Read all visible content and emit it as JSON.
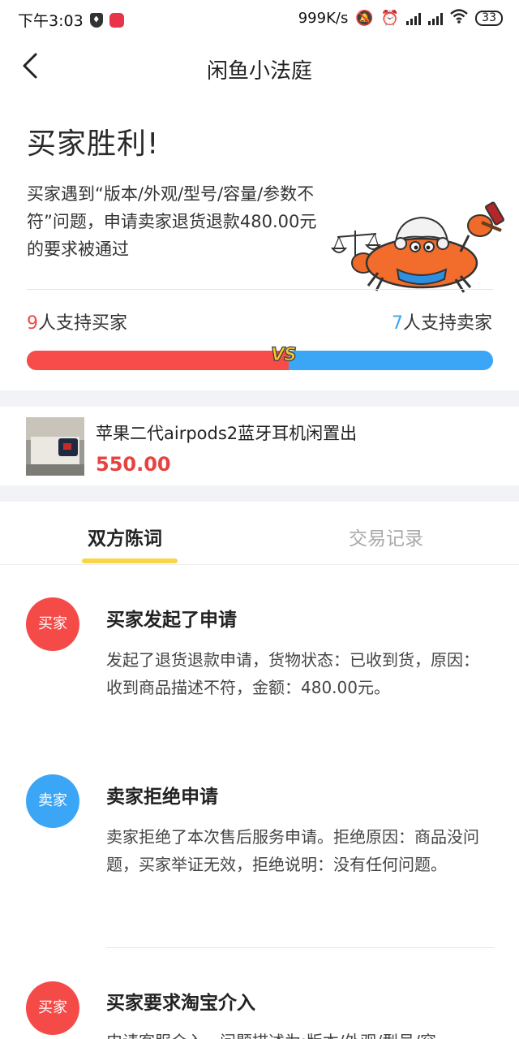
{
  "status_bar": {
    "time": "下午3:03",
    "network_speed": "999K/s",
    "battery": "33"
  },
  "header": {
    "title": "闲鱼小法庭"
  },
  "verdict": {
    "title": "买家胜利!",
    "description": "买家遇到“版本/外观/型号/容量/参数不符”问题，申请卖家退货退款480.00元的要求被通过"
  },
  "support": {
    "buyer_count": "9",
    "buyer_label": "人支持买家",
    "seller_count": "7",
    "seller_label": "人支持卖家",
    "buyer_share": 0.5625,
    "vs_label": "VS"
  },
  "product": {
    "name": "苹果二代airpods2蓝牙耳机闲置出",
    "price": "550.00"
  },
  "tabs": [
    {
      "label": "双方陈词",
      "active": true
    },
    {
      "label": "交易记录",
      "active": false
    }
  ],
  "timeline": [
    {
      "role": "买家",
      "role_color": "#f44b49",
      "title": "买家发起了申请",
      "body": "发起了退货退款申请，货物状态：已收到货，原因：收到商品描述不符，金额：480.00元。"
    },
    {
      "role": "卖家",
      "role_color": "#3aa6f5",
      "title": "卖家拒绝申请",
      "body": "卖家拒绝了本次售后服务申请。拒绝原因：商品没问题，买家举证无效，拒绝说明：没有任何问题。"
    },
    {
      "role": "买家",
      "role_color": "#f44b49",
      "title": "买家要求淘宝介入",
      "body": "申请客服介入，问题描述为:版本/外观/型号/容"
    }
  ],
  "colors": {
    "buyer_red": "#f84c4b",
    "seller_blue": "#3aa6f5",
    "price_red": "#e8423f",
    "tab_accent": "#f8d649"
  }
}
